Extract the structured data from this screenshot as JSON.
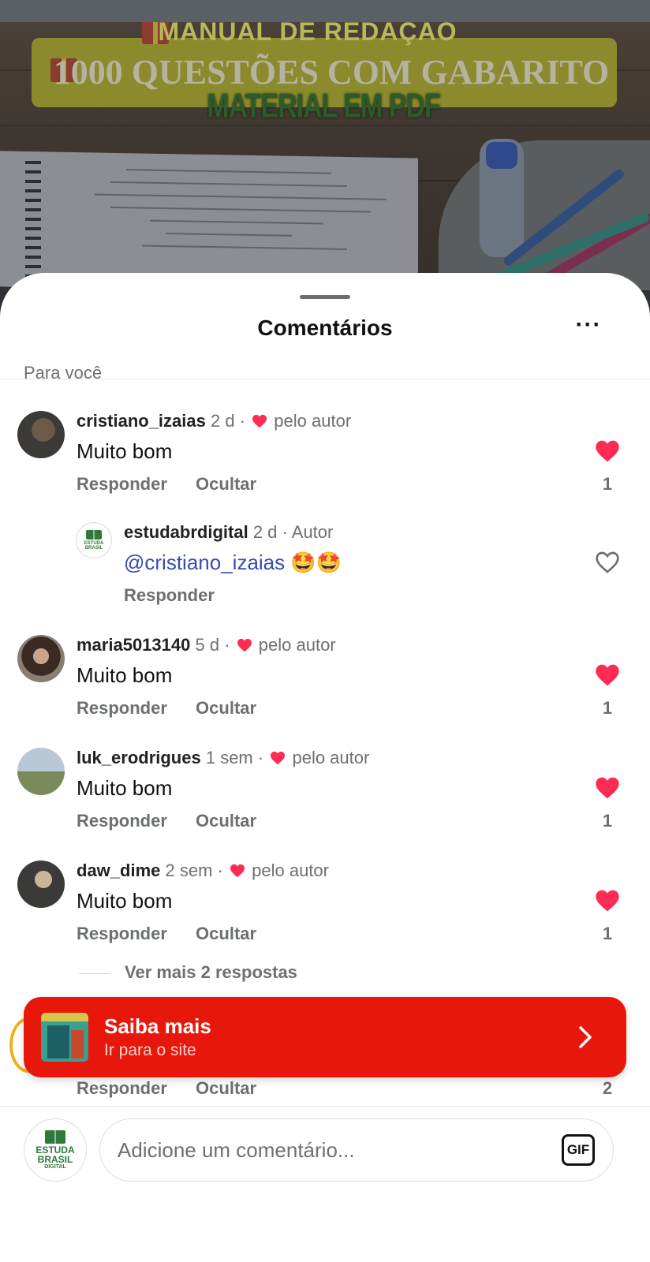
{
  "post_background": {
    "banner_line1": "MANUAL DE REDAÇÃO",
    "banner_line2": "1000 QUESTÕES COM GABARITO",
    "banner_line3": "MATERIAL EM PDF"
  },
  "sheet": {
    "title": "Comentários",
    "more_label": "···",
    "filter_label": "Para você"
  },
  "comments": [
    {
      "username": "cristiano_izaias",
      "time": "2 d",
      "author_like": "pelo autor",
      "text": "Muito bom",
      "reply_label": "Responder",
      "hide_label": "Ocultar",
      "liked": true,
      "likes": "1"
    },
    {
      "username": "maria5013140",
      "time": "5 d",
      "author_like": "pelo autor",
      "text": "Muito bom",
      "reply_label": "Responder",
      "hide_label": "Ocultar",
      "liked": true,
      "likes": "1"
    },
    {
      "username": "luk_erodrigues",
      "time": "1 sem",
      "author_like": "pelo autor",
      "text": "Muito bom",
      "reply_label": "Responder",
      "hide_label": "Ocultar",
      "liked": true,
      "likes": "1"
    },
    {
      "username": "daw_dime",
      "time": "2 sem",
      "author_like": "pelo autor",
      "text": "Muito bom",
      "reply_label": "Responder",
      "hide_label": "Ocultar",
      "liked": true,
      "likes": "1"
    }
  ],
  "reply": {
    "username": "estudabrdigital",
    "time": "2 d",
    "author_tag": "Autor",
    "mention": "@cristiano_izaias",
    "emoji": "🤩🤩",
    "reply_label": "Responder",
    "liked": false
  },
  "more_replies_label": "Ver mais 2 respostas",
  "partial_comment": {
    "reply_label": "Responder",
    "hide_label": "Ocultar",
    "likes": "2"
  },
  "cta": {
    "title": "Saiba mais",
    "subtitle": "Ir para o site"
  },
  "composer": {
    "placeholder": "Adicione um comentário...",
    "gif_label": "GIF"
  },
  "logo_text": {
    "line1": "ESTUDA",
    "line2": "BRASIL",
    "line3": "DIGITAL"
  },
  "colors": {
    "like_red": "#fe2c55",
    "cta_red": "#e8170b",
    "mention_blue": "#3b4bb0",
    "muted_gray": "#6c6f74"
  },
  "icons": {
    "heart": "heart-icon",
    "heart_outline": "heart-outline-icon",
    "chevron": "chevron-right-icon",
    "gift": "gift-icon"
  }
}
